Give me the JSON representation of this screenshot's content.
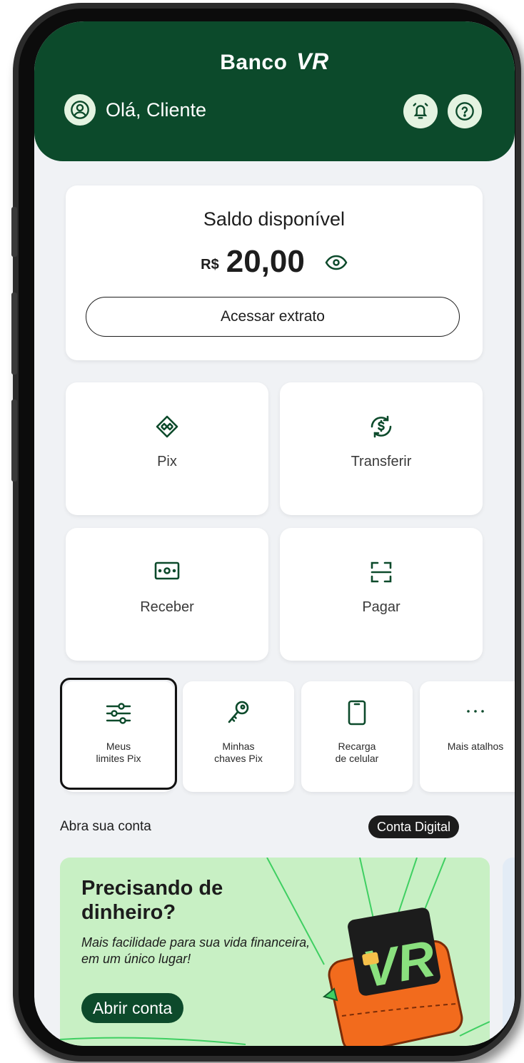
{
  "header": {
    "brand_name": "Banco",
    "brand_mark": "VR",
    "greeting": "Olá, Cliente",
    "icons": [
      "user-icon",
      "alarm-icon",
      "help-icon"
    ]
  },
  "balance": {
    "title": "Saldo disponível",
    "currency": "R$",
    "amount": "20,00",
    "statement_button": "Acessar extrato"
  },
  "actions": [
    {
      "label": "Pix",
      "icon": "pix-icon"
    },
    {
      "label": "Transferir",
      "icon": "transfer-icon"
    },
    {
      "label": "Receber",
      "icon": "receive-icon"
    },
    {
      "label": "Pagar",
      "icon": "scan-icon"
    }
  ],
  "shortcuts": [
    {
      "line1": "Meus",
      "line2": "limites Pix",
      "icon": "sliders-icon"
    },
    {
      "line1": "Minhas",
      "line2": "chaves Pix",
      "icon": "key-icon"
    },
    {
      "line1": "Recarga",
      "line2": "de celular",
      "icon": "phone-icon"
    },
    {
      "line1": "",
      "line2": "Mais atalhos",
      "icon": "more-icon"
    }
  ],
  "account": {
    "label": "Abra sua conta",
    "badge": "Conta Digital"
  },
  "promo": {
    "title": "Precisando de dinheiro?",
    "subtitle": "Mais facilidade para sua vida financeira, em um único lugar!",
    "button": "Abrir conta",
    "card_mark": "VR"
  },
  "colors": {
    "brand_green": "#0c4a2b",
    "promo_bg": "#c8f0c4",
    "accent_orange": "#f26b1d",
    "accent_lime": "#8ae07e"
  }
}
